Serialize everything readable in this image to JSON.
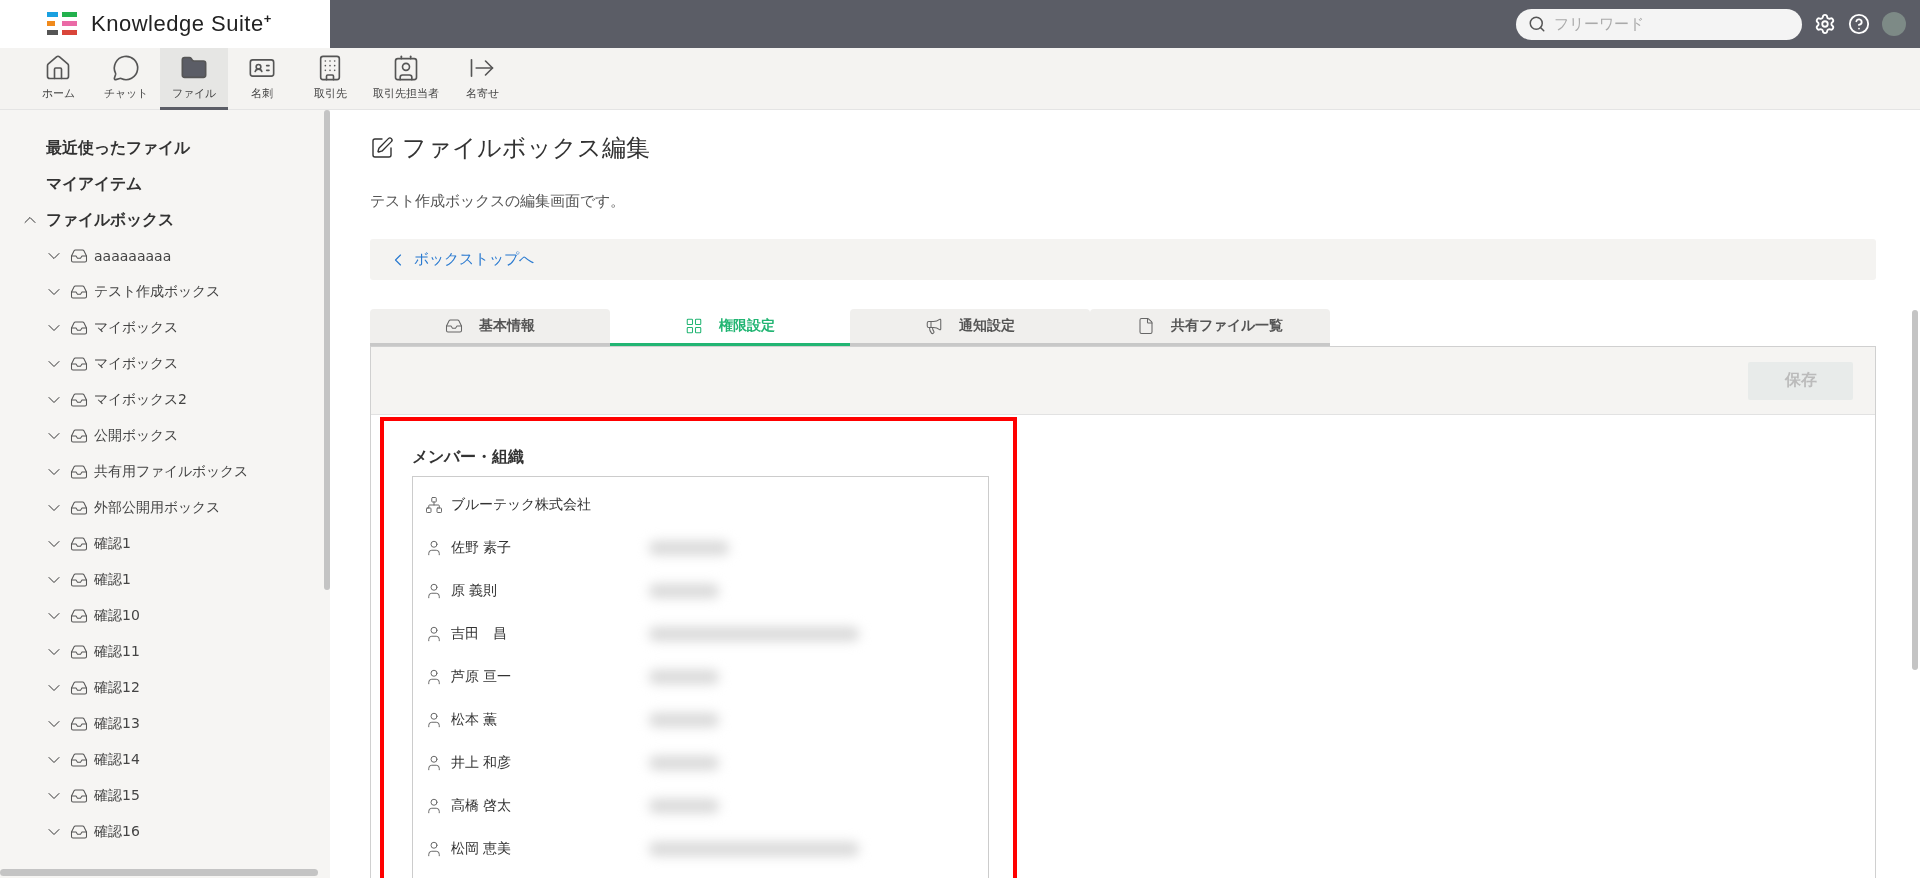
{
  "header": {
    "logo_text": "Knowledge Suite",
    "logo_mark": "+",
    "search": {
      "placeholder": "フリーワード"
    }
  },
  "nav": [
    {
      "label": "ホーム",
      "selected": false
    },
    {
      "label": "チャット",
      "selected": false
    },
    {
      "label": "ファイル",
      "selected": true
    },
    {
      "label": "名刺",
      "selected": false
    },
    {
      "label": "取引先",
      "selected": false
    },
    {
      "label": "取引先担当者",
      "selected": false
    },
    {
      "label": "名寄せ",
      "selected": false
    }
  ],
  "sidebar": {
    "items": [
      {
        "label": "最近使ったファイル"
      },
      {
        "label": "マイアイテム"
      },
      {
        "label": "ファイルボックス",
        "expanded": true,
        "children": [
          {
            "label": "aaaaaaaaa",
            "expanded": false
          },
          {
            "label": "テスト作成ボックス",
            "expanded": false
          },
          {
            "label": "マイボックス",
            "expanded": false
          },
          {
            "label": "マイボックス",
            "expanded": false
          },
          {
            "label": "マイボックス2",
            "expanded": false
          },
          {
            "label": "公開ボックス",
            "expanded": false
          },
          {
            "label": "共有用ファイルボックス",
            "expanded": false
          },
          {
            "label": "外部公開用ボックス",
            "expanded": false
          },
          {
            "label": "確認1",
            "expanded": false
          },
          {
            "label": "確認1",
            "expanded": false
          },
          {
            "label": "確認10",
            "expanded": false
          },
          {
            "label": "確認11",
            "expanded": false
          },
          {
            "label": "確認12",
            "expanded": false
          },
          {
            "label": "確認13",
            "expanded": false
          },
          {
            "label": "確認14",
            "expanded": false
          },
          {
            "label": "確認15",
            "expanded": false
          },
          {
            "label": "確認16",
            "expanded": false
          }
        ]
      }
    ]
  },
  "page": {
    "title": "ファイルボックス編集",
    "description": "テスト作成ボックスの編集画面です。",
    "back_link": "ボックストップへ"
  },
  "tabs": [
    {
      "label": "基本情報",
      "selected": false
    },
    {
      "label": "権限設定",
      "selected": true
    },
    {
      "label": "通知設定",
      "selected": false
    },
    {
      "label": "共有ファイル一覧",
      "selected": false
    }
  ],
  "save_button": {
    "label": "保存",
    "disabled": true
  },
  "members": {
    "heading": "メンバー・組織",
    "rows": [
      {
        "kind": "organization",
        "name": "ブルーテック株式会社"
      },
      {
        "kind": "member",
        "name": "佐野 素子"
      },
      {
        "kind": "member",
        "name": "原 義則"
      },
      {
        "kind": "member",
        "name": "吉田　昌"
      },
      {
        "kind": "member",
        "name": "芦原 亘一"
      },
      {
        "kind": "member",
        "name": "松本 薫"
      },
      {
        "kind": "member",
        "name": "井上 和彦"
      },
      {
        "kind": "member",
        "name": "高橋 啓太"
      },
      {
        "kind": "member",
        "name": "松岡 恵美"
      }
    ]
  }
}
